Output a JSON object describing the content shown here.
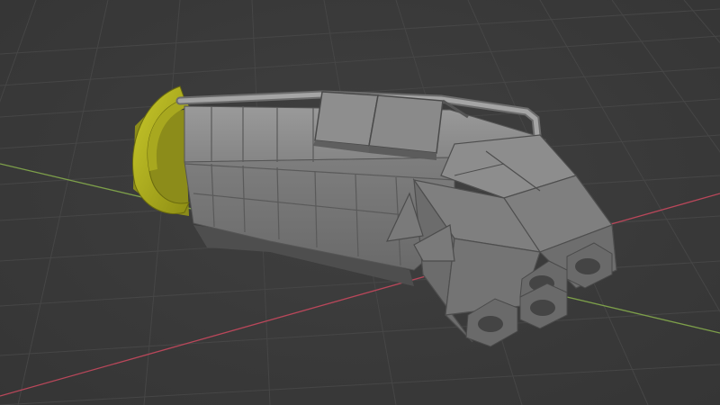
{
  "viewport": {
    "background": "#3b3b3b",
    "grid_color": "#4a4a4a",
    "axis_x_color": "#c04a5a",
    "axis_y_color": "#7fa44c",
    "active_selection_color": "#b5b51e",
    "mesh_color": "#8a8a8a"
  },
  "scene": {
    "object": "hull-model",
    "selected_part": "ring-collar"
  }
}
